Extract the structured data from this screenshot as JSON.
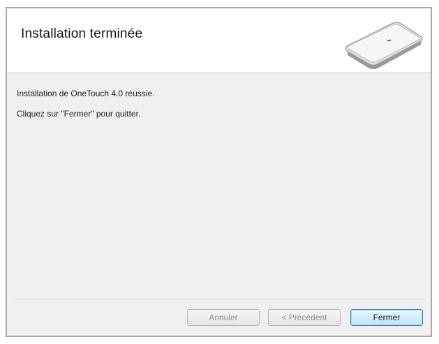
{
  "header": {
    "title": "Installation terminée",
    "graphic_icon": "scanner-icon"
  },
  "content": {
    "line1": "Installation de OneTouch 4.0 réussie.",
    "line2": "Cliquez sur \"Fermer\" pour quitter."
  },
  "footer": {
    "cancel_label": "Annuler",
    "previous_label": "< Précédent",
    "close_label": "Fermer"
  },
  "colors": {
    "content_bg": "#f0f0f0",
    "default_button_border": "#3c7fb1",
    "disabled_text": "#8c8c8c"
  }
}
